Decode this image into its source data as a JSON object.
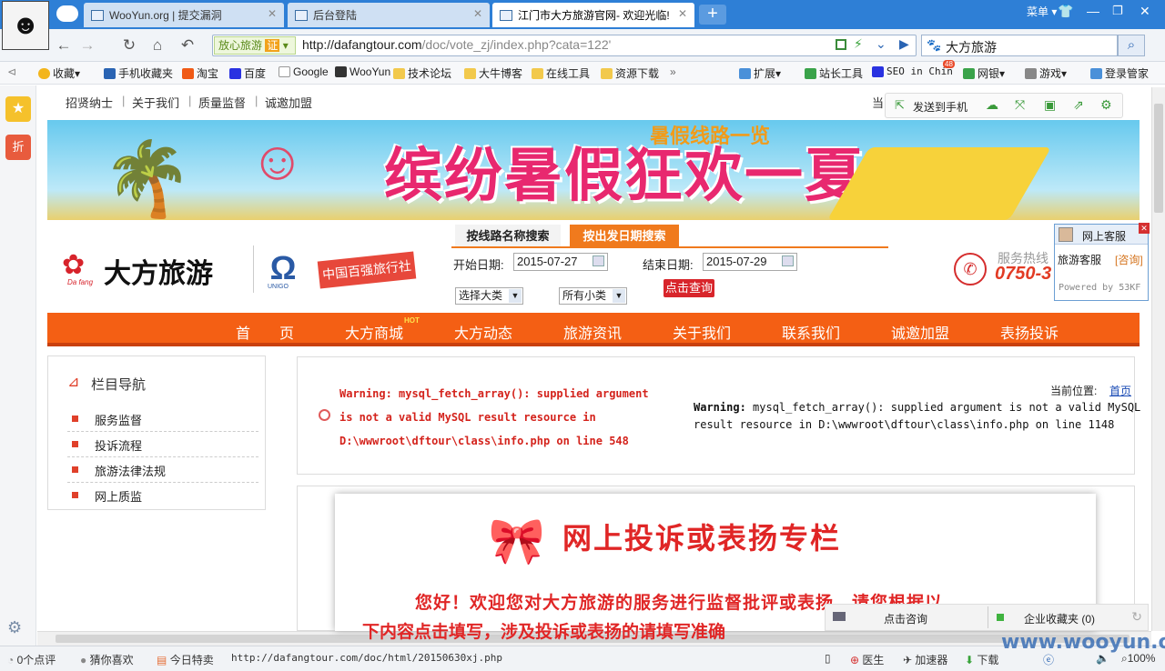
{
  "browser": {
    "tabs": [
      {
        "label": "WooYun.org | 提交漏洞"
      },
      {
        "label": "后台登陆"
      },
      {
        "label": "江门市大方旅游官网- 欢迎光临!"
      }
    ],
    "new_tab": "+",
    "menu_label": "菜单",
    "safe_badge": "放心旅游",
    "safe_badge_mark": "证",
    "url_host": "http://dafangtour.com",
    "url_path": "/doc/vote_zj/index.php?cata=122'",
    "search_value": "大方旅游",
    "bookmarks": [
      "收藏",
      "手机收藏夹",
      "淘宝",
      "百度",
      "Google",
      "WooYun",
      "技术论坛",
      "大牛博客",
      "在线工具",
      "资源下载",
      "»",
      "扩展",
      "站长工具",
      "SEO in Chin",
      "网银",
      "游戏",
      "登录管家"
    ],
    "bookmark_badge": "48"
  },
  "site": {
    "top_links": [
      "招贤纳士",
      "关于我们",
      "质量监督",
      "诚邀加盟"
    ],
    "top_sep": "|",
    "current_pos_partial": "当",
    "send_to_phone": "发送到手机",
    "banner_title": "缤纷暑假狂欢一夏",
    "banner_subtitle": "暑假线路一览",
    "logo_text": "大方旅游",
    "logo_sub": "Da fang",
    "logo2_text": "UNIGO",
    "ribbon_text": "中国百强旅行社",
    "search_tabs": [
      "按线路名称搜索",
      "按出发日期搜索"
    ],
    "start_label": "开始日期:",
    "start_value": "2015-07-27",
    "end_label": "结束日期:",
    "end_value": "2015-07-29",
    "select_big": "选择大类",
    "select_small": "所有小类",
    "search_button": "点击查询",
    "hotline_label": "服务热线",
    "hotline_number": "0750-3",
    "kefu_title": "网上客服",
    "kefu_item": "旅游客服",
    "kefu_consult": "[咨询]",
    "kefu_powered": "Powered by 53KF",
    "main_nav": [
      "首　　页",
      "大方商城",
      "大方动态",
      "旅游资讯",
      "关于我们",
      "联系我们",
      "诚邀加盟",
      "表扬投诉"
    ],
    "hot_badge": "HOT",
    "column_nav_title": "栏目导航",
    "column_nav_items": [
      "服务监督",
      "投诉流程",
      "旅游法律法规",
      "网上质监"
    ],
    "warning_left_prefix": "Warning:",
    "warning_left": " mysql_fetch_array(): supplied argument is not a valid MySQL result resource in D:\\wwwroot\\dftour\\class\\info.php on line 548",
    "current_position_label": "当前位置:",
    "current_position_link": "首页",
    "warning_right_prefix": "Warning:",
    "warning_right_line1": " mysql_fetch_array(): supplied argument is not a valid MySQL",
    "warning_right_line2": "result resource in D:\\wwwroot\\dftour\\class\\info.php on line 1148",
    "content_title": "网上投诉或表扬专栏",
    "welcome_line1": "您好！欢迎您对大方旅游的服务进行监督批评或表扬，请您根据以",
    "welcome_line2": "下内容点击填写，涉及投诉或表扬的请填写准确",
    "float_consult": "点击咨询",
    "float_fav": "企业收藏夹 (0)"
  },
  "status": {
    "comments": "0个点评",
    "guess": "猜你喜欢",
    "today": "今日特卖",
    "hover_url": "http://dafangtour.com/doc/html/20150630xj.php",
    "doctor": "医生",
    "accelerator": "加速器",
    "download": "下载",
    "zoom": "100%"
  },
  "watermark": "www.wooyun.org"
}
